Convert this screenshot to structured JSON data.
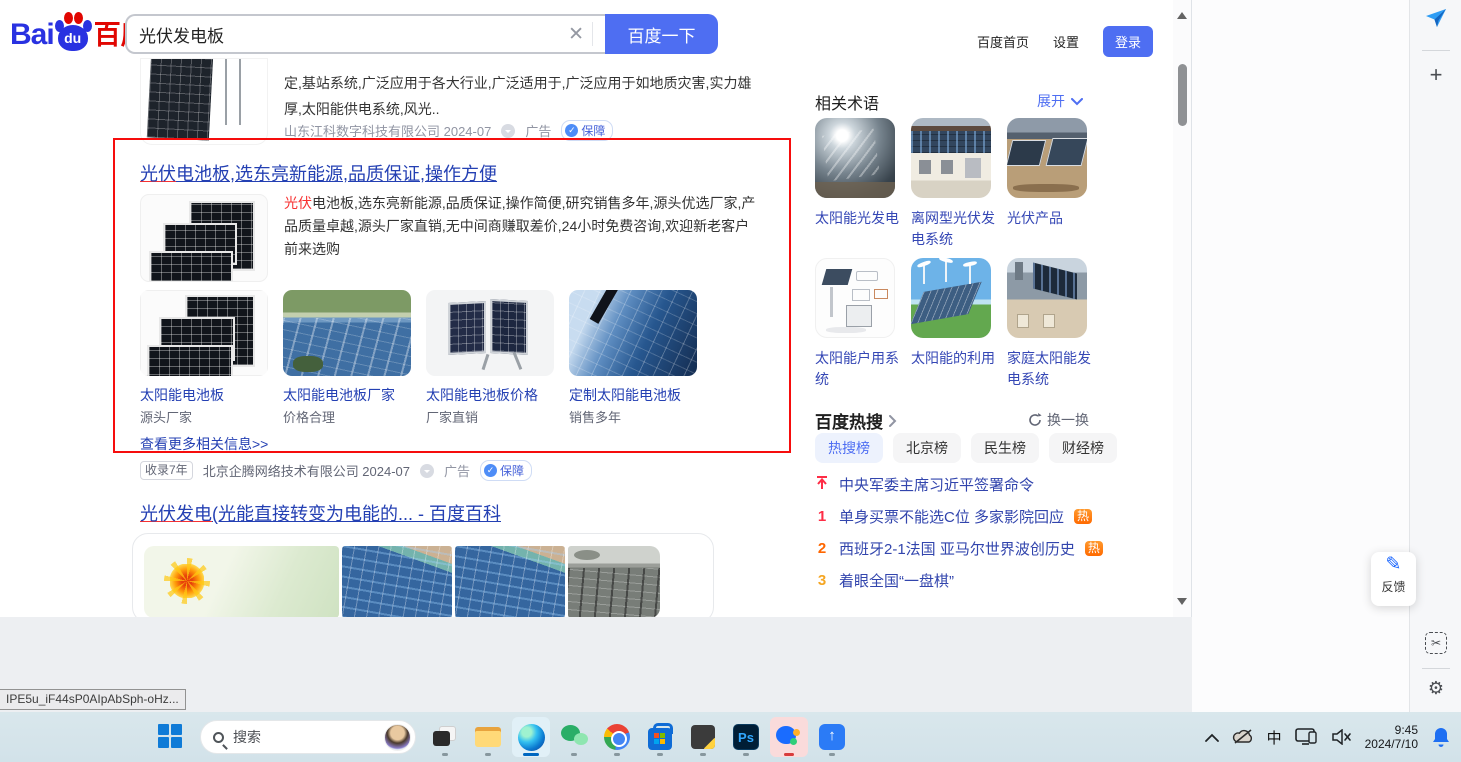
{
  "colors": {
    "accent_blue": "#4e6ef2",
    "title_blue": "#2440b3",
    "highlight_red": "#f73131",
    "red_box": "#f60d0d",
    "hot_tag_orange": "#ff6a00",
    "source_gray": "#9195a3",
    "taskbar_bg": "#d5e4ea"
  },
  "browser": {
    "header": {
      "logo_bai": "Bai",
      "logo_du": "du",
      "logo_cn": "百度",
      "search_value": "光伏发电板",
      "clear_x": "✕",
      "search_button": "百度一下",
      "nav_home": "百度首页",
      "nav_settings": "设置",
      "login": "登录"
    },
    "results": {
      "partial_top": {
        "desc": "定,基站系统,广泛应用于各大行业,广泛适用于,广泛应用于如地质灾害,实力雄厚,太阳能供电系统,风光..",
        "source": "山东江科数字科技有限公司 2024-07",
        "ad_label": "广告",
        "badge_check": "✓",
        "badge": "保障"
      },
      "ad": {
        "title_em": "光伏",
        "title_rest": "电池板,选东亮新能源,品质保证,操作方便",
        "desc_em": "光伏",
        "desc_rest": "电池板,选东亮新能源,品质保证,操作简便,研究销售多年,源头优选厂家,产品质量卓越,源头厂家直销,无中间商赚取差价,24小时免费咨询,欢迎新老客户前来选购",
        "cards": [
          {
            "title": "太阳能电池板",
            "subtitle": "源头厂家"
          },
          {
            "title": "太阳能电池板厂家",
            "subtitle": "价格合理"
          },
          {
            "title": "太阳能电池板价格",
            "subtitle": "厂家直销"
          },
          {
            "title": "定制太阳能电池板",
            "subtitle": "销售多年"
          }
        ],
        "more_link": "查看更多相关信息>>",
        "age_badge": "收录7年",
        "source": "北京企腾网络技术有限公司 2024-07",
        "ad_label": "广告",
        "badge_check": "✓",
        "badge": "保障"
      },
      "baike": {
        "title_em": "光伏发电",
        "title_rest": "(光能直接转变为电能的... - 百度百科"
      }
    },
    "rail": {
      "related": {
        "title": "相关术语",
        "expand": "展开",
        "items": [
          {
            "label": "太阳能光发电"
          },
          {
            "label": "离网型光伏发电系统"
          },
          {
            "label": "光伏产品"
          },
          {
            "label": "太阳能户用系统"
          },
          {
            "label": "太阳能的利用"
          },
          {
            "label": "家庭太阳能发电系统"
          }
        ]
      },
      "hot": {
        "title": "百度热搜",
        "refresh": "换一换",
        "tabs": [
          {
            "label": "热搜榜"
          },
          {
            "label": "北京榜"
          },
          {
            "label": "民生榜"
          },
          {
            "label": "财经榜"
          }
        ],
        "items": [
          {
            "rank": "",
            "text": "中央军委主席习近平签署命令",
            "tag": ""
          },
          {
            "rank": "1",
            "text": "单身买票不能选C位 多家影院回应",
            "tag": "热"
          },
          {
            "rank": "2",
            "text": "西班牙2-1法国 亚马尔世界波创历史",
            "tag": "热"
          },
          {
            "rank": "3",
            "text": "着眼全国“一盘棋”",
            "tag": ""
          }
        ]
      }
    },
    "feedback": {
      "icon": "✎",
      "label": "反馈"
    },
    "sidebar": {
      "plus": "+",
      "scissors": "✂",
      "gear": "⚙"
    },
    "status_tooltip": "IPE5u_iF44sP0AIpAbSph-oHz..."
  },
  "taskbar": {
    "search_placeholder": "搜索",
    "ps_label": "Ps",
    "docs_arrow": "↑",
    "ime": "中",
    "time": "9:45",
    "date": "2024/7/10"
  }
}
